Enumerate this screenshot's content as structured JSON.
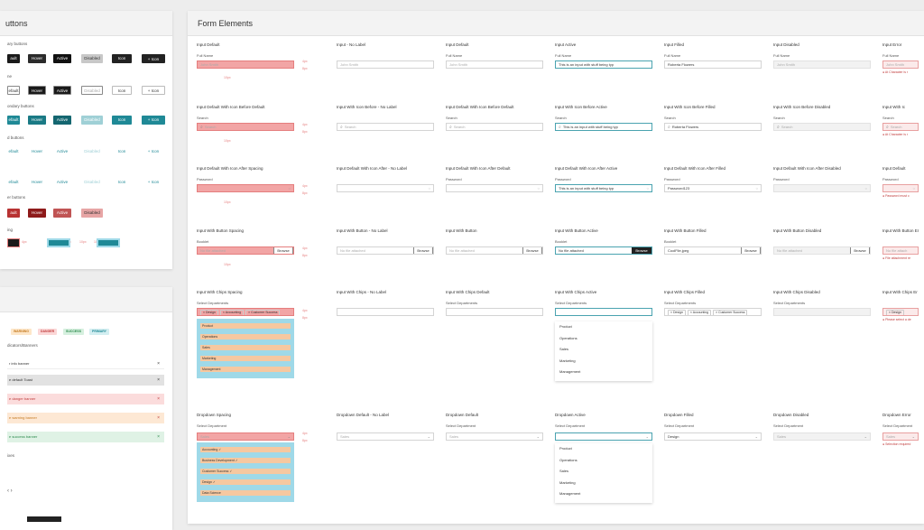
{
  "buttons_panel": {
    "title": "uttons",
    "rows": [
      {
        "label": "ary buttons",
        "items": [
          "ault",
          "Hover",
          "Active",
          "Disabled",
          "Icon",
          "+ Icon"
        ]
      },
      {
        "label": "ne",
        "items": [
          "efault",
          "Hover",
          "Active",
          "Disabled",
          "Icon",
          "+ Icon"
        ]
      },
      {
        "label": "ondary buttons",
        "items": [
          "efault",
          "Hover",
          "Active",
          "Disabled",
          "Icon",
          "+ Icon"
        ]
      },
      {
        "label": "d buttons",
        "items": [
          "efault",
          "Hover",
          "Active",
          "Disabled",
          "Icon",
          "+ Icon"
        ]
      },
      {
        "label": "",
        "items": [
          "efault",
          "Hover",
          "Active",
          "Disabled",
          "Icon",
          "+ Icon"
        ]
      },
      {
        "label": "er buttons",
        "items": [
          "ault",
          "Hover",
          "Active",
          "Disabled"
        ]
      },
      {
        "label": "ing",
        "items": [
          "4px",
          "4px",
          "4px",
          "4px",
          "10px",
          "10px"
        ]
      }
    ]
  },
  "badges": [
    "WARNING",
    "DANGER",
    "SUCCESS",
    "PRIMARY"
  ],
  "banners": {
    "title": "dicators/Banners",
    "items": [
      "r info banner",
      "e default Toast",
      "e danger banner",
      "e warning banner",
      "e success banner"
    ],
    "more": "ixes"
  },
  "form": {
    "title": "Form Elements",
    "rows": [
      {
        "headers": [
          "Input Default",
          "Input - No Label",
          "Input Default",
          "Input Active",
          "Input Filled",
          "Input Disabled",
          "Input Error"
        ],
        "labels": [
          "Full Name",
          "",
          "Full Name",
          "Full Name",
          "Full Name",
          "Full Name",
          "Full Name"
        ],
        "values": [
          "John Smith",
          "John Smith",
          "John Smith",
          "This is an input with stuff being typ",
          "Roberta Flowers",
          "John Smith",
          "John Smith"
        ],
        "error": "At Character is r"
      },
      {
        "headers": [
          "Input Default With Icon Before Default",
          "Input With Icon Before - No Label",
          "Input Default With Icon Before Default",
          "Input With Icon Before Active",
          "Input With Icon Before Filled",
          "Input With Icon Before Disabled",
          "Input With Ic"
        ],
        "labels": [
          "Search",
          "",
          "Search",
          "Search",
          "Search",
          "Search",
          "Search"
        ],
        "values": [
          "Search",
          "Search",
          "Search",
          "This is an input with stuff being typ",
          "Roberta Flowers",
          "Search",
          "Search"
        ],
        "error": "At Character is r"
      },
      {
        "headers": [
          "Input Default With Icon After Spacing",
          "Input Default With Icon After - No Label",
          "Input Default With Icon After Default",
          "Input Default With Icon After Active",
          "Input Default With Icon After Filled",
          "Input Default With Icon After Disabled",
          "Input Default"
        ],
        "labels": [
          "Password",
          "",
          "Password",
          "Password",
          "Password",
          "Password",
          "Password"
        ],
        "values": [
          "",
          "",
          "",
          "This is an input with stuff being typ",
          "Password123",
          "",
          ""
        ],
        "error": "Password must c"
      },
      {
        "headers": [
          "Input With Button Spacing",
          "Input With Button - No Label",
          "Input With Button",
          "Input With Button Active",
          "Input With Button Filled",
          "Input With Button Disabled",
          "Input With Button Er"
        ],
        "labels": [
          "Booklet",
          "",
          "",
          "Booklet",
          "Booklet",
          "",
          ""
        ],
        "values": [
          "No file attached",
          "No file attached",
          "No file attached",
          "No file attached",
          "CoolFile.jpeg",
          "No file attached",
          "No file attach"
        ],
        "button": "Browse",
        "error": "File attachment re"
      },
      {
        "headers": [
          "Input With Chips Spacing",
          "Input With Chips - No Label",
          "Input With Chips Default",
          "Input With Chips Active",
          "Input With Chips Filled",
          "Input With Chips Disabled",
          "Input With Chips Er"
        ],
        "labels": [
          "Select Departments",
          "",
          "Select Departments",
          "Select Departments",
          "Select Departments",
          "Select Departments",
          ""
        ],
        "chips": [
          "Design",
          "Accounting",
          "Customer Success"
        ],
        "error": "Please select a de"
      },
      {
        "headers": [
          "Dropdown Spacing",
          "Dropdown Default - No Label",
          "Dropdown Default",
          "Dropdown Active",
          "Dropdown Filled",
          "Dropdown Disabled",
          "Dropdown Error"
        ],
        "labels": [
          "Select Department",
          "",
          "Select Department",
          "Select Department",
          "Select Department",
          "Select Department",
          "Select Department"
        ],
        "values": [
          "Sales",
          "Sales",
          "Sales",
          "",
          "Design",
          "Sales",
          "Sales"
        ],
        "error": "Selection required"
      }
    ],
    "chips_menu": [
      "Product",
      "Operations",
      "Sales",
      "Marketing",
      "Management"
    ],
    "dropdown_menu": [
      "Product",
      "Operations",
      "Sales",
      "Marketing",
      "Management"
    ],
    "spacing_list": [
      "Accounting",
      "Business Development",
      "Customer Success",
      "Design",
      "Data Science"
    ],
    "spacing_labels": [
      "4px",
      "8px",
      "10px",
      "16px"
    ]
  }
}
